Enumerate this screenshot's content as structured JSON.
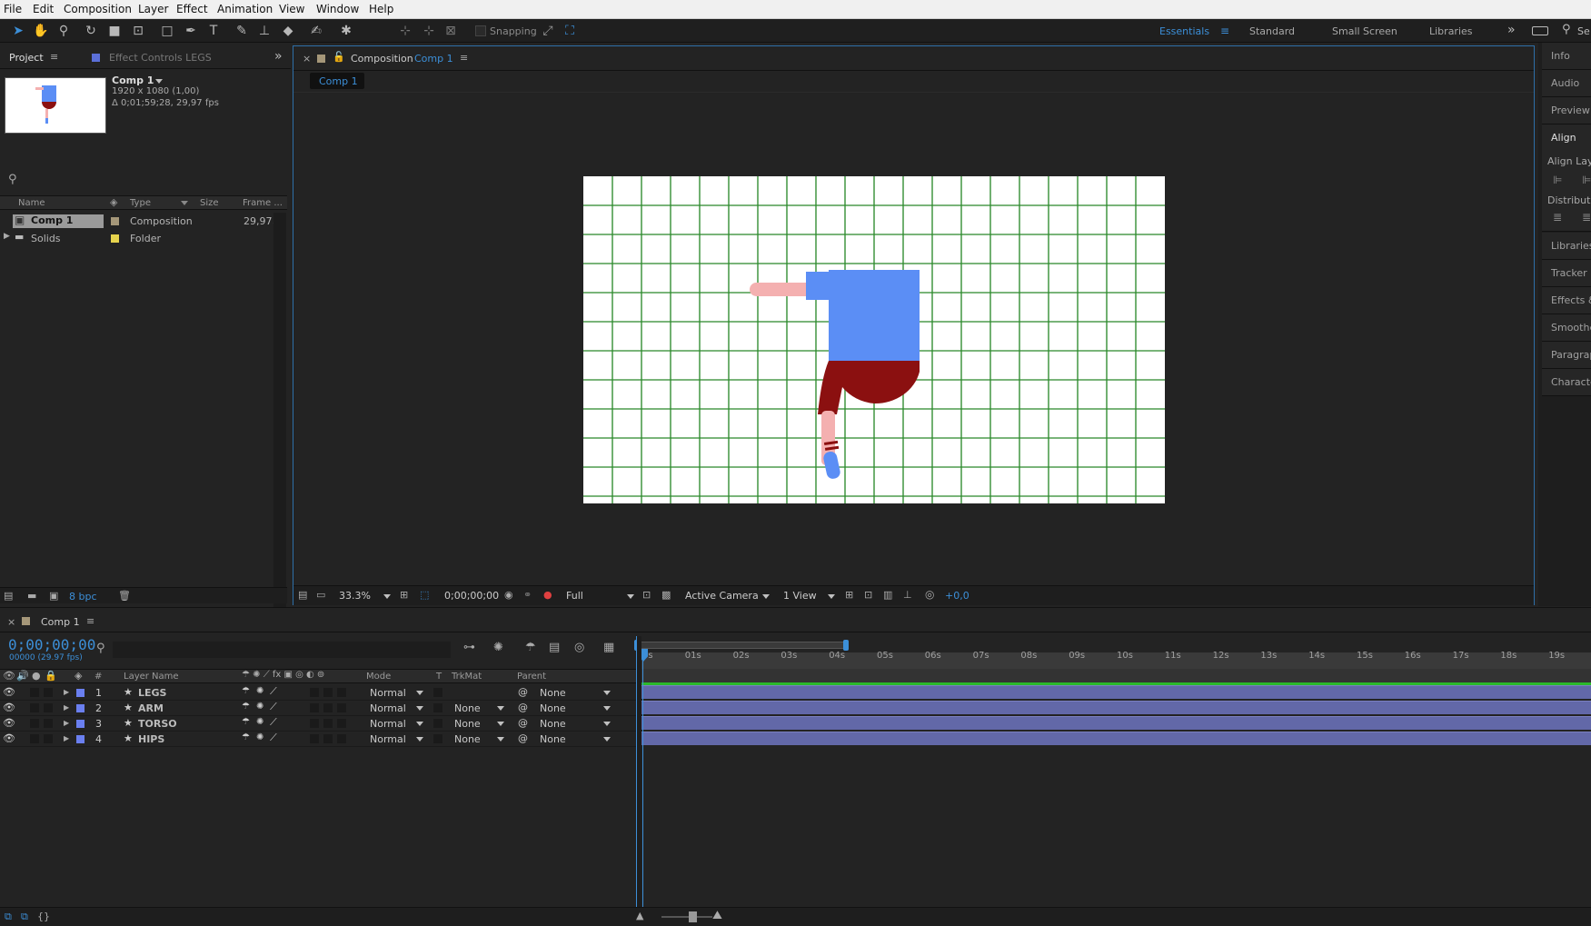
{
  "menu": [
    "File",
    "Edit",
    "Composition",
    "Layer",
    "Effect",
    "Animation",
    "View",
    "Window",
    "Help"
  ],
  "toolbar": {
    "snapping_label": "Snapping",
    "workspaces": [
      "Essentials",
      "Standard",
      "Small Screen",
      "Libraries"
    ],
    "active_workspace": "Essentials",
    "search_label": "Se"
  },
  "project": {
    "tab_label": "Project",
    "effect_tab_label": "Effect Controls LEGS",
    "comp_name": "Comp 1",
    "comp_res": "1920 x 1080 (1,00)",
    "comp_dur": "Δ 0;01;59;28, 29,97 fps",
    "columns": {
      "name": "Name",
      "type": "Type",
      "size": "Size",
      "frame": "Frame ..."
    },
    "items": [
      {
        "name": "Comp 1",
        "type": "Composition",
        "frame": "29,97",
        "label_color": "#a59779"
      },
      {
        "name": "Solids",
        "type": "Folder",
        "frame": "",
        "label_color": "#e6d34d"
      }
    ],
    "bpc": "8 bpc"
  },
  "viewer": {
    "tab_prefix": "Composition",
    "tab_name": "Comp 1",
    "crumb": "Comp 1",
    "zoom": "33.3%",
    "timecode": "0;00;00;00",
    "resolution": "Full",
    "camera": "Active Camera",
    "views": "1 View",
    "exposure": "+0,0"
  },
  "right_panels": [
    "Info",
    "Audio",
    "Preview",
    "Align",
    "Align Laye",
    "Distribute",
    "Libraries",
    "Tracker",
    "Effects &",
    "Smoothe",
    "Paragrap",
    "Characte"
  ],
  "timeline": {
    "tab_name": "Comp 1",
    "timecode": "0;00;00;00",
    "frame_info": "00000 (29.97 fps)",
    "columns": {
      "num": "#",
      "layer": "Layer Name",
      "mode": "Mode",
      "t": "T",
      "trkmat": "TrkMat",
      "parent": "Parent"
    },
    "layers": [
      {
        "num": "1",
        "name": "LEGS",
        "mode": "Normal",
        "trkmat": "",
        "parent": "None"
      },
      {
        "num": "2",
        "name": "ARM",
        "mode": "Normal",
        "trkmat": "None",
        "parent": "None"
      },
      {
        "num": "3",
        "name": "TORSO",
        "mode": "Normal",
        "trkmat": "None",
        "parent": "None"
      },
      {
        "num": "4",
        "name": "HIPS",
        "mode": "Normal",
        "trkmat": "None",
        "parent": "None"
      }
    ],
    "ruler": [
      "0s",
      "01s",
      "02s",
      "03s",
      "04s",
      "05s",
      "06s",
      "07s",
      "08s",
      "09s",
      "10s",
      "11s",
      "12s",
      "13s",
      "14s",
      "15s",
      "16s",
      "17s",
      "18s",
      "19s"
    ]
  },
  "colors": {
    "accent": "#3c8fd8",
    "layer_label": "#6a7ff0",
    "layer_bar": "#6268a8",
    "grid": "#2e8b2e",
    "sleeve": "#5b8ef5",
    "shorts": "#8b1010",
    "skin": "#f4b0b0"
  }
}
